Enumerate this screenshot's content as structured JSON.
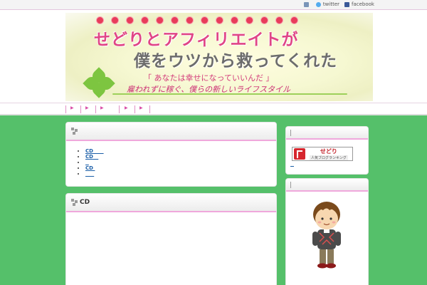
{
  "social": {
    "hatena_label": "",
    "twitter_label": "twitter",
    "facebook_label": "facebook"
  },
  "header": {
    "title_line1": "せどりとアフィリエイトが",
    "title_line2": "僕をウツから救ってくれた",
    "tagline1": "「 あなたは幸せになっていいんだ 」",
    "tagline2": "雇われずに稼ぐ、僕らの新しいライフスタイル"
  },
  "nav": {
    "items": [
      "",
      "",
      "",
      "",
      ""
    ]
  },
  "main": {
    "panel1": {
      "title": "",
      "items": [
        "CD",
        "CD",
        "",
        "CD",
        ""
      ]
    },
    "panel2": {
      "title": "CD"
    }
  },
  "sidebar": {
    "ranking_line1": "せどり",
    "ranking_line2": "人気ブログランキング"
  },
  "colors": {
    "background": "#55c06a",
    "accent_pink": "#f0a8dc",
    "title_pink": "#e04686",
    "link_blue": "#1a5ea8"
  }
}
